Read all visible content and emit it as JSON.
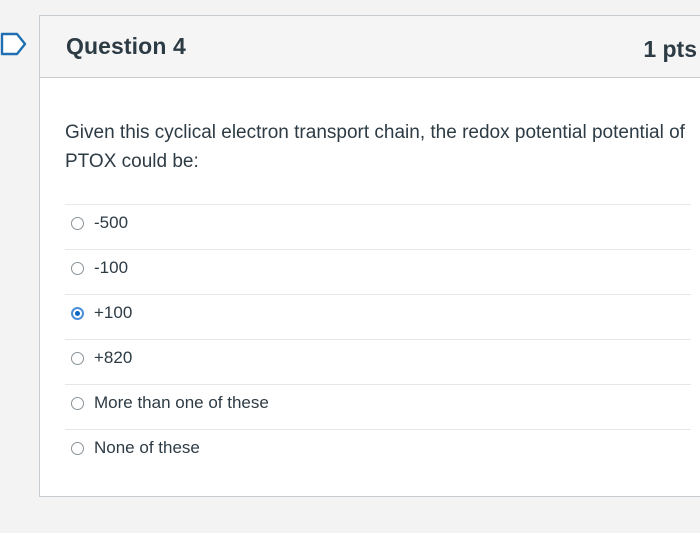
{
  "question": {
    "title": "Question 4",
    "points": "1 pts",
    "text": "Given this cyclical electron transport chain, the redox potential potential of PTOX could be:"
  },
  "answers": [
    {
      "label": "-500",
      "selected": false
    },
    {
      "label": "-100",
      "selected": false
    },
    {
      "label": "+100",
      "selected": true
    },
    {
      "label": "+820",
      "selected": false
    },
    {
      "label": "More than one of these",
      "selected": false
    },
    {
      "label": "None of these",
      "selected": false
    }
  ],
  "colors": {
    "accent": "#0b66c3",
    "text": "#2d3b45",
    "header_bg": "#f5f5f5",
    "border": "#c7cdd1"
  },
  "icons": {
    "flag": "bookmark-flag-icon"
  }
}
